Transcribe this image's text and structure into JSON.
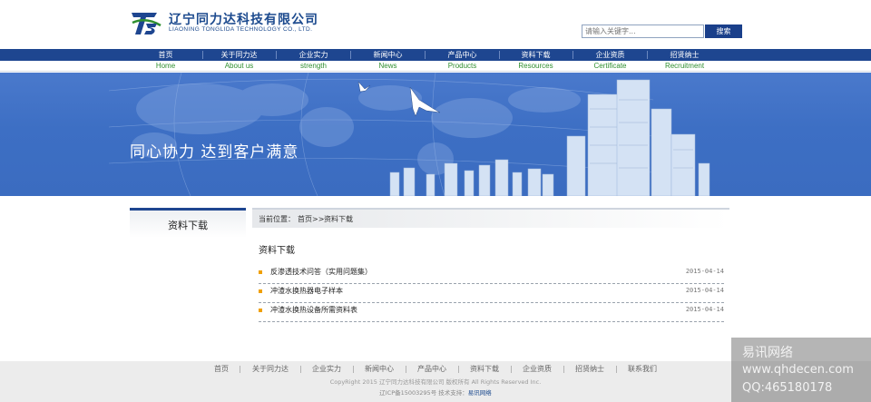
{
  "header": {
    "company_cn": "辽宁同力达科技有限公司",
    "company_en": "LIAONING TONGLIDA TECHNOLOGY CO., LTD.",
    "logo_icon": "tld-logo-icon",
    "brand_color": "#1e4690",
    "search_placeholder": "请输入关键字...",
    "search_button": "搜索"
  },
  "nav": [
    {
      "cn": "首页",
      "en": "Home"
    },
    {
      "cn": "关于同力达",
      "en": "About us"
    },
    {
      "cn": "企业实力",
      "en": "strength"
    },
    {
      "cn": "新闻中心",
      "en": "News"
    },
    {
      "cn": "产品中心",
      "en": "Products"
    },
    {
      "cn": "资料下载",
      "en": "Resources"
    },
    {
      "cn": "企业资质",
      "en": "Certificate"
    },
    {
      "cn": "招贤纳士",
      "en": "Recruitment"
    }
  ],
  "banner": {
    "slogan": "同心协力 达到客户满意"
  },
  "sidebar": {
    "title": "资料下载"
  },
  "breadcrumb": {
    "label": "当前位置：",
    "home": "首页>>",
    "current": "资料下载"
  },
  "content": {
    "title": "资料下载",
    "items": [
      {
        "title": "反渗透技术问答（实用问题集）",
        "date": "2015-04-14"
      },
      {
        "title": "冲渣水换热器电子样本",
        "date": "2015-04-14"
      },
      {
        "title": "冲渣水换热设备所需资料表",
        "date": "2015-04-14"
      }
    ]
  },
  "footer": {
    "links": [
      "首页",
      "关于同力达",
      "企业实力",
      "新闻中心",
      "产品中心",
      "资料下载",
      "企业资质",
      "招贤纳士",
      "联系我们"
    ],
    "separator": "|",
    "copyright": "CopyRight 2015 辽宁同力达科技有限公司  版权所有 All Rights Reserved Inc.",
    "icp": "辽ICP备15003295号  技术支持：",
    "support": "易讯网络"
  },
  "watermark": {
    "line1": "易讯网络",
    "line2": "www.qhdecen.com",
    "line3": "QQ:465180178"
  }
}
